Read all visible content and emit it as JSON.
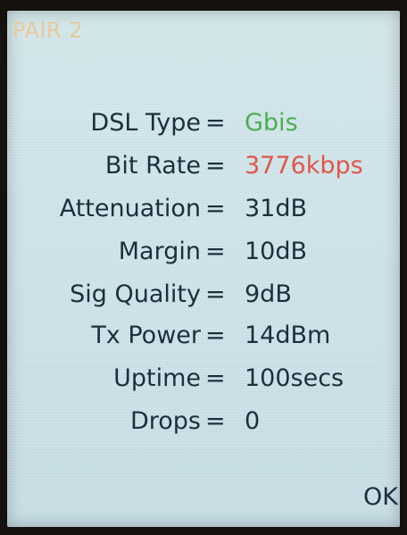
{
  "screen": {
    "title": "PAIR 2",
    "ok_label": "OK"
  },
  "stats": [
    {
      "label": "DSL Type",
      "eq": "=",
      "value": "Gbis",
      "value_color": "#4caf50"
    },
    {
      "label": "Bit Rate",
      "eq": "=",
      "value": "3776kbps",
      "value_color": "#e0574a"
    },
    {
      "label": "Attenuation",
      "eq": "=",
      "value": "31dB",
      "value_color": "#1d2e3c"
    },
    {
      "label": "Margin",
      "eq": "=",
      "value": "10dB",
      "value_color": "#1d2e3c"
    },
    {
      "label": "Sig Quality",
      "eq": "=",
      "value": "9dB",
      "value_color": "#1d2e3c"
    },
    {
      "label": "Tx Power",
      "eq": "=",
      "value": "14dBm",
      "value_color": "#1d2e3c"
    },
    {
      "label": "Uptime",
      "eq": "=",
      "value": "100secs",
      "value_color": "#1d2e3c"
    },
    {
      "label": "Drops",
      "eq": "=",
      "value": "0",
      "value_color": "#1d2e3c"
    }
  ],
  "colors": {
    "title": "#e9c99a",
    "text": "#1d2e3c",
    "screen_background": "#cfe4ea"
  }
}
